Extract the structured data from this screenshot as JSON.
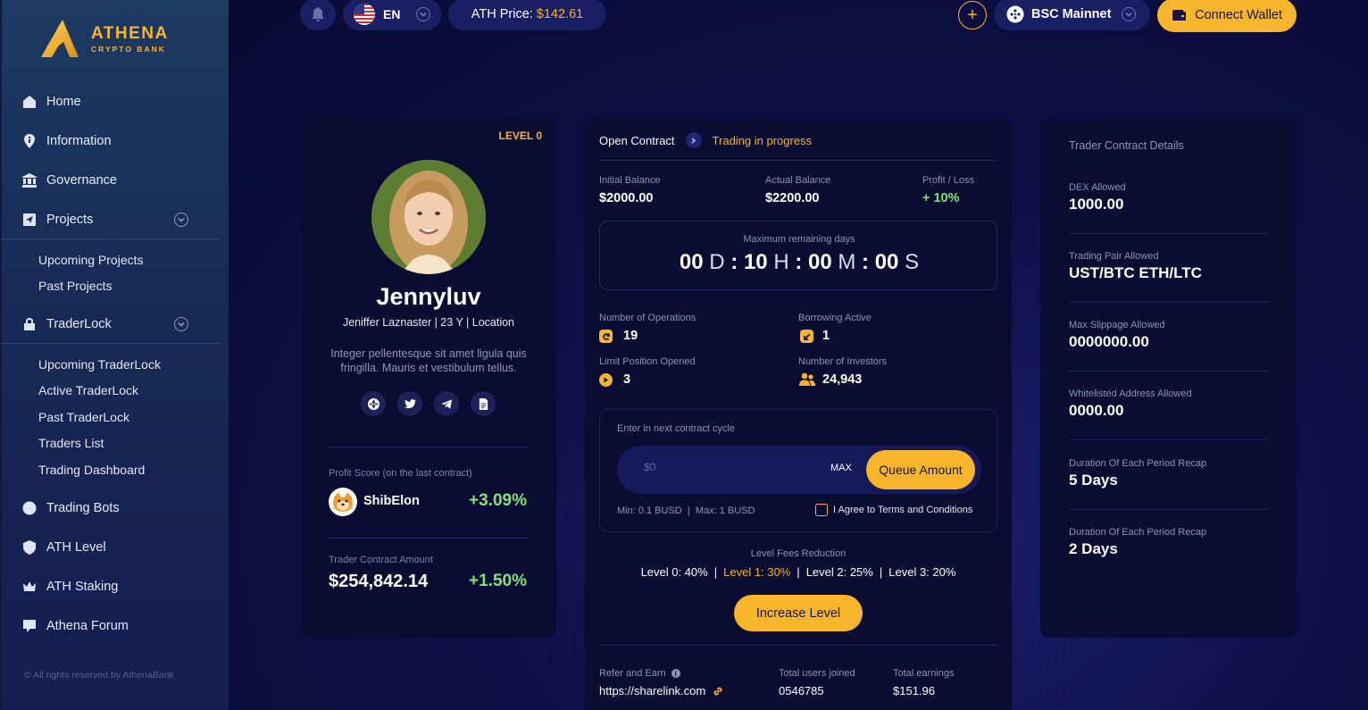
{
  "brand": {
    "name": "ATHENA",
    "tagline": "CRYPTO BANK"
  },
  "sidebar": {
    "items": [
      {
        "label": "Home",
        "icon": "home-icon"
      },
      {
        "label": "Information",
        "icon": "info-pin-icon"
      },
      {
        "label": "Governance",
        "icon": "bank-icon"
      },
      {
        "label": "Projects",
        "icon": "send-box-icon",
        "sub": [
          "Upcoming Projects",
          "Past Projects"
        ]
      },
      {
        "label": "TraderLock",
        "icon": "lock-icon",
        "sub": [
          "Upcoming TraderLock",
          "Active TraderLock",
          "Past TraderLock",
          "Traders List",
          "Trading Dashboard"
        ]
      },
      {
        "label": "Trading Bots",
        "icon": "bot-icon"
      },
      {
        "label": "ATH Level",
        "icon": "shield-check-icon"
      },
      {
        "label": "ATH Staking",
        "icon": "crown-icon"
      },
      {
        "label": "Athena Forum",
        "icon": "chat-icon"
      }
    ],
    "copyright": "© All rights reserved by AthenaBank"
  },
  "topbar": {
    "language": "EN",
    "price_label": "ATH Price:",
    "price_value": "$142.61",
    "network": "BSC Mainnet",
    "connect_label": "Connect Wallet"
  },
  "profile": {
    "level": "LEVEL 0",
    "name": "Jennyluv",
    "meta": "Jeniffer Laznaster | 23 Y | Location",
    "bio": "Integer pellentesque sit amet ligula quis fringilla. Mauris et vestibulum tellus.",
    "socials": [
      "globe-icon",
      "twitter-icon",
      "telegram-icon",
      "document-icon"
    ],
    "profit_label": "Profit Score (on the last contract)",
    "coin_name": "ShibElon",
    "coin_pct": "+3.09%",
    "amount_label": "Trader Contract Amount",
    "amount_value": "$254,842.14",
    "amount_pct": "+1.50%"
  },
  "contract": {
    "open_label": "Open Contract",
    "status": "Trading in progress",
    "initial_label": "Initial Balance",
    "initial_value": "$2000.00",
    "actual_label": "Actual Balance",
    "actual_value": "$2200.00",
    "pl_label": "Profit / Loss",
    "pl_value": "+ 10%",
    "timer_label": "Maximum remaining days",
    "timer": {
      "d": "00",
      "h": "10",
      "m": "00",
      "s": "00"
    },
    "operations_label": "Number of Operations",
    "operations_value": "19",
    "borrowing_label": "Borrowing Active",
    "borrowing_value": "1",
    "limit_label": "Limit Position Opened",
    "limit_value": "3",
    "investors_label": "Number of Investors",
    "investors_value": "24,943",
    "queue_label": "Enter in next contract cycle",
    "queue_placeholder": "$0",
    "max_label": "MAX",
    "queue_button": "Queue Amount",
    "limits": "Min: 0.1 BUSD  |  Max: 1 BUSD",
    "agree": "I Agree to Terms and Conditions",
    "fees_title": "Level Fees Reduction",
    "fees": [
      "Level 0: 40%",
      "Level 1: 30%",
      "Level 2: 25%",
      "Level 3: 20%"
    ],
    "increase_button": "Increase Level",
    "refer_label": "Refer and Earn",
    "refer_link": "https://sharelink.com",
    "users_label": "Total users joined",
    "users_value": "0546785",
    "earnings_label": "Total earnings",
    "earnings_value": "$151.96"
  },
  "details": {
    "title": "Trader Contract Details",
    "rows": [
      {
        "label": "DEX Allowed",
        "value": "1000.00"
      },
      {
        "label": "Trading Pair Allowed",
        "value": "UST/BTC ETH/LTC"
      },
      {
        "label": "Max Slippage Allowed",
        "value": "0000000.00"
      },
      {
        "label": "Whitelisted Address Allowed",
        "value": "0000.00"
      },
      {
        "label": "Duration Of Each Period Recap",
        "value": "5 Days"
      },
      {
        "label": "Duration Of Each Period Recap",
        "value": "2 Days"
      }
    ]
  },
  "colors": {
    "accent": "#f7b52c",
    "positive": "#7fe37a",
    "background": "#0b0d3a",
    "card": "#0a0c31"
  }
}
